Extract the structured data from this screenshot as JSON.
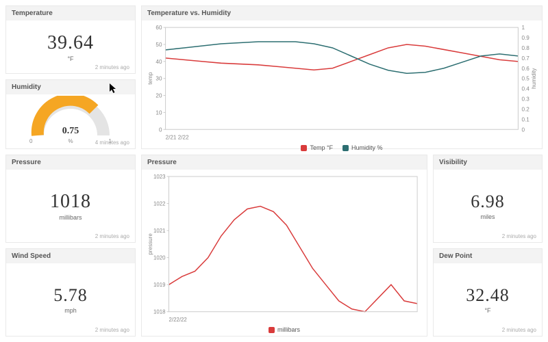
{
  "colors": {
    "temp": "#d93b3b",
    "humidity": "#2c6e71",
    "pressure": "#d93b3b",
    "gauge_fill": "#f5a623",
    "gauge_track": "#e4e4e4"
  },
  "cards": {
    "temperature": {
      "title": "Temperature",
      "value": "39.64",
      "unit": "°F",
      "timestamp": "2 minutes ago"
    },
    "humidity": {
      "title": "Humidity",
      "value": "0.75",
      "unit": "%",
      "min": "0",
      "max": "1",
      "timestamp": "4 minutes ago"
    },
    "pressure": {
      "title": "Pressure",
      "value": "1018",
      "unit": "millibars",
      "timestamp": "2 minutes ago"
    },
    "wind": {
      "title": "Wind Speed",
      "value": "5.78",
      "unit": "mph",
      "timestamp": "2 minutes ago"
    },
    "visibility": {
      "title": "Visibility",
      "value": "6.98",
      "unit": "miles",
      "timestamp": "2 minutes ago"
    },
    "dewpoint": {
      "title": "Dew Point",
      "value": "32.48",
      "unit": "°F",
      "timestamp": "2 minutes ago"
    }
  },
  "chart_data": [
    {
      "id": "temp_vs_humidity",
      "title": "Temperature vs. Humidity",
      "type": "line",
      "x": [
        0,
        1,
        2,
        3,
        4,
        5,
        6,
        7,
        8,
        9,
        10,
        11,
        12,
        13,
        14,
        15,
        16,
        17,
        18,
        19
      ],
      "x_tick_labels": [
        "2/21",
        "2/22"
      ],
      "series": [
        {
          "name": "Temp °F",
          "axis": "left",
          "color": "#d93b3b",
          "values": [
            42,
            41,
            40,
            39,
            38.5,
            38,
            37,
            36,
            35,
            36,
            40,
            44,
            48,
            50,
            49,
            47,
            45,
            43,
            41,
            40
          ]
        },
        {
          "name": "Humidity %",
          "axis": "right",
          "color": "#2c6e71",
          "values": [
            0.78,
            0.8,
            0.82,
            0.84,
            0.85,
            0.86,
            0.86,
            0.86,
            0.84,
            0.8,
            0.72,
            0.64,
            0.58,
            0.55,
            0.56,
            0.6,
            0.66,
            0.72,
            0.74,
            0.72
          ]
        }
      ],
      "y_left": {
        "label": "temp",
        "min": 0,
        "max": 60,
        "ticks": [
          0,
          10,
          20,
          30,
          40,
          50,
          60
        ]
      },
      "y_right": {
        "label": "humidity",
        "min": 0,
        "max": 1,
        "ticks": [
          0,
          0.1,
          0.2,
          0.3,
          0.4,
          0.5,
          0.6,
          0.7,
          0.8,
          0.9,
          1
        ]
      }
    },
    {
      "id": "pressure_trend",
      "title": "Pressure",
      "type": "line",
      "x": [
        0,
        1,
        2,
        3,
        4,
        5,
        6,
        7,
        8,
        9,
        10,
        11,
        12,
        13,
        14,
        15,
        16,
        17,
        18,
        19
      ],
      "x_tick_labels": [
        "2/22/22"
      ],
      "series": [
        {
          "name": "millibars",
          "color": "#d93b3b",
          "values": [
            1019.0,
            1019.3,
            1019.5,
            1020.0,
            1020.8,
            1021.4,
            1021.8,
            1021.9,
            1021.7,
            1021.2,
            1020.4,
            1019.6,
            1019.0,
            1018.4,
            1018.1,
            1018.0,
            1018.5,
            1019.0,
            1018.4,
            1018.3
          ]
        }
      ],
      "y_left": {
        "label": "pressure",
        "min": 1018,
        "max": 1023,
        "ticks": [
          1018,
          1019,
          1020,
          1021,
          1022,
          1023
        ]
      }
    }
  ],
  "legends": {
    "temp_vs_humidity": [
      {
        "label": "Temp °F",
        "color": "#d93b3b"
      },
      {
        "label": "Humidity %",
        "color": "#2c6e71"
      }
    ],
    "pressure_trend": [
      {
        "label": "millibars",
        "color": "#d93b3b"
      }
    ]
  }
}
